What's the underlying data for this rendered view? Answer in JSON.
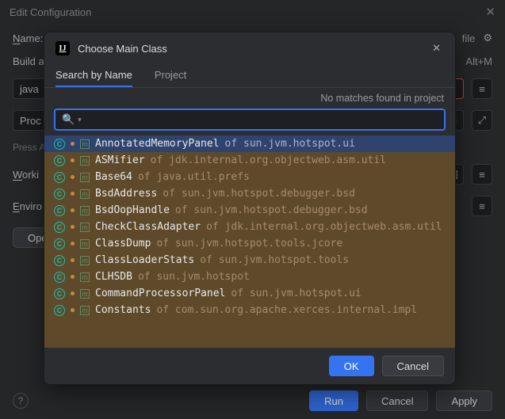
{
  "edit_config": {
    "title": "Edit Configuration",
    "name_label": "Name:",
    "build_label": "Build a",
    "java_field": "java",
    "proc_field": "Proc",
    "press_hint": "Press A",
    "working_label": "Working",
    "env_label": "Environ",
    "open_button": "Ope",
    "alt_hint": "Alt+M",
    "file_label": "file",
    "run": "Run",
    "cancel": "Cancel",
    "apply": "Apply"
  },
  "modal": {
    "title": "Choose Main Class",
    "tabs": {
      "search": "Search by Name",
      "project": "Project"
    },
    "status": "No matches found in project",
    "search_placeholder": "",
    "ok": "OK",
    "cancel": "Cancel",
    "results": [
      {
        "class": "AnnotatedMemoryPanel",
        "pkg": "of sun.jvm.hotspot.ui",
        "selected": true
      },
      {
        "class": "ASMifier",
        "pkg": "of jdk.internal.org.objectweb.asm.util"
      },
      {
        "class": "Base64",
        "pkg": "of java.util.prefs"
      },
      {
        "class": "BsdAddress",
        "pkg": "of sun.jvm.hotspot.debugger.bsd"
      },
      {
        "class": "BsdOopHandle",
        "pkg": "of sun.jvm.hotspot.debugger.bsd"
      },
      {
        "class": "CheckClassAdapter",
        "pkg": "of jdk.internal.org.objectweb.asm.util"
      },
      {
        "class": "ClassDump",
        "pkg": "of sun.jvm.hotspot.tools.jcore"
      },
      {
        "class": "ClassLoaderStats",
        "pkg": "of sun.jvm.hotspot.tools"
      },
      {
        "class": "CLHSDB",
        "pkg": "of sun.jvm.hotspot"
      },
      {
        "class": "CommandProcessorPanel",
        "pkg": "of sun.jvm.hotspot.ui"
      },
      {
        "class": "Constants",
        "pkg": "of com.sun.org.apache.xerces.internal.impl"
      }
    ]
  }
}
